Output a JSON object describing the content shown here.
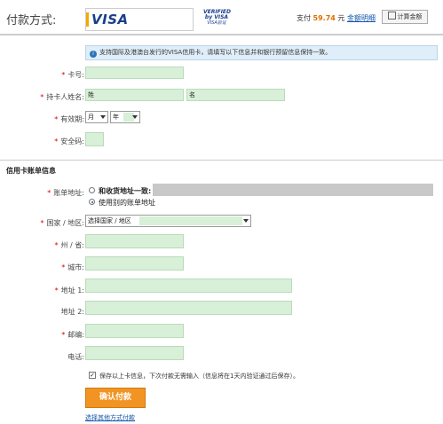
{
  "header": {
    "title": "付款方式:",
    "visa_logo": "VISA",
    "verified_line1": "VERIFIED",
    "verified_line2": "by VISA",
    "verified_line3": "VISA验证",
    "pay_prefix": "支付",
    "pay_amount": "59.74",
    "pay_unit": "元",
    "pay_detail_link": "金额明细",
    "calc_button": "计算金额"
  },
  "info_message": "支持国际及港澳台发行的VISA信用卡，请填写以下信息并和银行预留信息保持一致。",
  "card_form": {
    "card_number_label": "卡号:",
    "holder_label": "持卡人姓名:",
    "first_name_value": "姓",
    "last_name_value": "名",
    "expiry_label": "有效期:",
    "month_value": "月",
    "year_value": "年",
    "cvv_label": "安全码:"
  },
  "billing": {
    "section_title": "信用卡账单信息",
    "address_label": "账单地址:",
    "same_address_option": "和收货地址一致:",
    "other_address_option": "使用别的账单地址",
    "country_label": "国家 / 地区:",
    "country_value": "选择国家 / 地区",
    "state_label": "州 / 省:",
    "city_label": "城市:",
    "address1_label": "地址 1:",
    "address2_label": "地址 2:",
    "zip_label": "邮编:",
    "phone_label": "电话:",
    "save_info_text": "保存以上卡信息，下次付款无需输入（信息将在1天内验证通过后保存）。",
    "save_checkbox_mark": "✓"
  },
  "actions": {
    "confirm_pay": "确认付款",
    "other_method_link": "选择其他方式付款"
  },
  "required_mark": "*",
  "colors": {
    "input_fill": "#d8efd8",
    "pay_button": "#f29423",
    "amount": "#e06e00",
    "link": "#1155aa",
    "required": "#dd0000",
    "info_bg": "#dfeef8"
  }
}
